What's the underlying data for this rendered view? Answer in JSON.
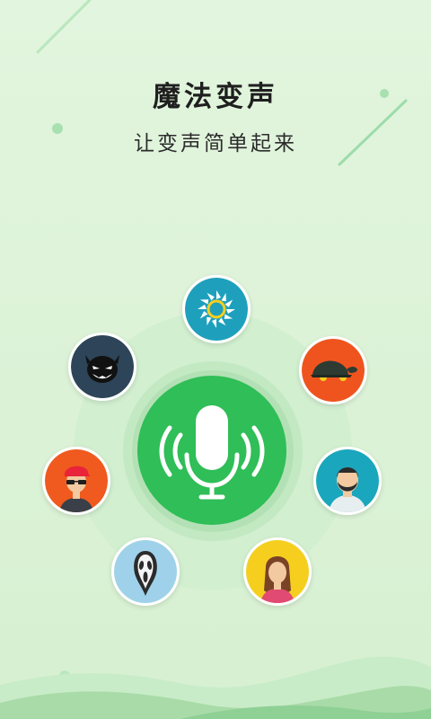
{
  "header": {
    "title": "魔法变声",
    "subtitle": "让变声简单起来"
  },
  "voice_effects": [
    {
      "id": "spin",
      "icon": "spinner-icon",
      "color": "#1ea0bd"
    },
    {
      "id": "turtle",
      "icon": "turtle-icon",
      "color": "#f0541e"
    },
    {
      "id": "man",
      "icon": "bearded-man-icon",
      "color": "#1aa6bd"
    },
    {
      "id": "woman",
      "icon": "woman-icon",
      "color": "#f06a1e"
    },
    {
      "id": "ghost",
      "icon": "ghost-mask-icon",
      "color": "#9fd2ea"
    },
    {
      "id": "boy",
      "icon": "boy-sunglasses-icon",
      "color": "#f05a1e"
    },
    {
      "id": "devil",
      "icon": "devil-icon",
      "color": "#2d4459"
    }
  ],
  "colors": {
    "background": "#e2f5de",
    "mic_green": "#2fbe57",
    "wave_green": "#a9dba9"
  },
  "mic": {
    "icon": "microphone-icon"
  }
}
